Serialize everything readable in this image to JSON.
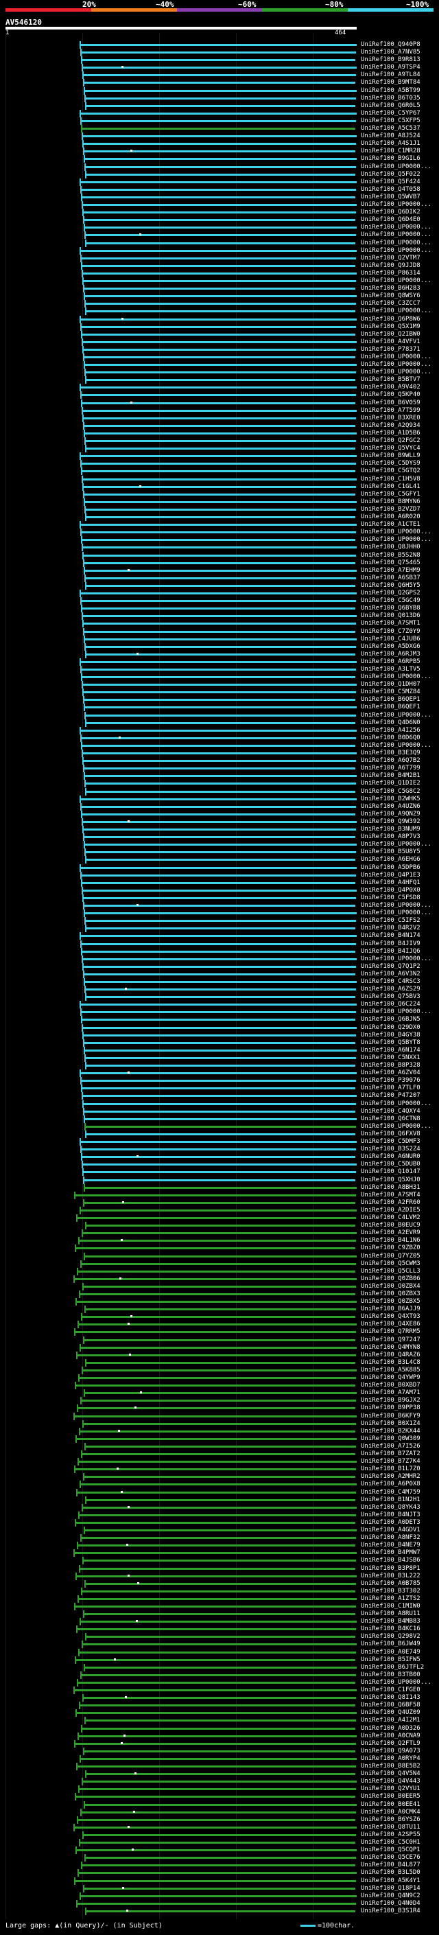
{
  "scale": {
    "labels": [
      "20%",
      "~40%",
      "~60%",
      "~80%",
      "~100%"
    ],
    "colors": [
      "#e8232b",
      "#f07c1d",
      "#8c3db0",
      "#2ea02b",
      "#3fd0ea"
    ]
  },
  "query": {
    "name": "AV546120",
    "start": "1",
    "end": "464"
  },
  "footer": {
    "large_gaps": "Large gaps: ▲(in Query)/- (in Subject)",
    "legend_label": "=100char."
  },
  "hits": [
    "UniRef100_Q940P8",
    "UniRef100_A7NV85",
    "UniRef100_B9R813",
    "UniRef100_A9TSP4",
    "UniRef100_A9TL84",
    "UniRef100_B9MT84",
    "UniRef100_A5BT99",
    "UniRef100_B6T035",
    "UniRef100_Q6R0L5",
    "UniRef100_C5YP67",
    "UniRef100_C5XFP5",
    "UniRef100_A5C537",
    "UniRef100_A8J524",
    "UniRef100_A4S1J1",
    "UniRef100_C1MR28",
    "UniRef100_B9GIL6",
    "UniRef100_UP0000...",
    "UniRef100_Q5F022",
    "UniRef100_Q5F424",
    "UniRef100_Q4T058",
    "UniRef100_Q5WVB7",
    "UniRef100_UP0000...",
    "UniRef100_Q6DIK2",
    "UniRef100_Q6D4E0",
    "UniRef100_UP0000...",
    "UniRef100_UP0000...",
    "UniRef100_UP0000...",
    "UniRef100_UP0000...",
    "UniRef100_Q2VTM7",
    "UniRef100_Q9JJD8",
    "UniRef100_P86314",
    "UniRef100_UP0000...",
    "UniRef100_B6H283",
    "UniRef100_Q8WSY6",
    "UniRef100_C3ZCC7",
    "UniRef100_UP0000...",
    "UniRef100_Q6P8W6",
    "UniRef100_Q5X1M9",
    "UniRef100_Q2IBW0",
    "UniRef100_A4VFV1",
    "UniRef100_P78371",
    "UniRef100_UP0000...",
    "UniRef100_UP0000...",
    "UniRef100_UP0000...",
    "UniRef100_B5BTV7",
    "UniRef100_A9V402",
    "UniRef100_Q5KP40",
    "UniRef100_B6V059",
    "UniRef100_A7T599",
    "UniRef100_B3XRE0",
    "UniRef100_A2Q934",
    "UniRef100_A1D5B6",
    "UniRef100_Q2FGC2",
    "UniRef100_Q5VYC4",
    "UniRef100_B9WLL9",
    "UniRef100_C5DYS9",
    "UniRef100_C5GTQ2",
    "UniRef100_C1H5V8",
    "UniRef100_C1GL41",
    "UniRef100_C5GFY1",
    "UniRef100_B8MYN6",
    "UniRef100_B2VZD7",
    "UniRef100_A6R020",
    "UniRef100_A1CTE1",
    "UniRef100_UP0000...",
    "UniRef100_UP0000...",
    "UniRef100_Q8JHH0",
    "UniRef100_B5S2N8",
    "UniRef100_Q75465",
    "UniRef100_A7EHM9",
    "UniRef100_A6SB37",
    "UniRef100_Q6H5Y5",
    "UniRef100_Q2GPS2",
    "UniRef100_C5GC49",
    "UniRef100_Q6BYB8",
    "UniRef100_Q013D6",
    "UniRef100_A7SMT1",
    "UniRef100_C7Z0Y9",
    "UniRef100_C4JUB6",
    "UniRef100_A5DXG6",
    "UniRef100_A6RJM3",
    "UniRef100_A6RPB5",
    "UniRef100_A3LTV5",
    "UniRef100_UP0000...",
    "UniRef100_Q1DH07",
    "UniRef100_C5MZ84",
    "UniRef100_B6QEP1",
    "UniRef100_B6QEF1",
    "UniRef100_UP0000...",
    "UniRef100_Q4D6N0",
    "UniRef100_A4I256",
    "UniRef100_B0D6Q0",
    "UniRef100_UP0000...",
    "UniRef100_B3E3Q9",
    "UniRef100_A6Q7B2",
    "UniRef100_A6T799",
    "UniRef100_B4M2B1",
    "UniRef100_Q1DIE2",
    "UniRef100_C5G8C2",
    "UniRef100_B2WHK5",
    "UniRef100_A4UZN6",
    "UniRef100_A9QNZ9",
    "UniRef100_Q9W392",
    "UniRef100_B3NUM9",
    "UniRef100_A8P7V3",
    "UniRef100_UP0000...",
    "UniRef100_B5U8Y5",
    "UniRef100_A6EHG6",
    "UniRef100_A5DPB6",
    "UniRef100_Q4P1E3",
    "UniRef100_A4HFQ1",
    "UniRef100_Q4P0X0",
    "UniRef100_C5FSD8",
    "UniRef100_UP0000...",
    "UniRef100_UP0000...",
    "UniRef100_C5IFS2",
    "UniRef100_B4R2V2",
    "UniRef100_B4N174",
    "UniRef100_B4JIV9",
    "UniRef100_B4IJQ6",
    "UniRef100_UP0000...",
    "UniRef100_Q7Q1P2",
    "UniRef100_A6V3N2",
    "UniRef100_C4RSC3",
    "UniRef100_A6ZS29",
    "UniRef100_Q75BV3",
    "UniRef100_Q6C224",
    "UniRef100_UP0000...",
    "UniRef100_Q6BJN5",
    "UniRef100_Q29DX0",
    "UniRef100_B4GY38",
    "UniRef100_Q5BYT8",
    "UniRef100_A6N174",
    "UniRef100_C5NXX1",
    "UniRef100_B8P328",
    "UniRef100_A6ZV04",
    "UniRef100_P39076",
    "UniRef100_A7TLF0",
    "UniRef100_P47207",
    "UniRef100_UP0000...",
    "UniRef100_C4QXY4",
    "UniRef100_Q6CTN8",
    "UniRef100_UP0000...",
    "UniRef100_Q6FXV8",
    "UniRef100_C5DMF3",
    "UniRef100_B3S2Z4",
    "UniRef100_A6NUR0",
    "UniRef100_C5DUB0",
    "UniRef100_Q10147",
    "UniRef100_Q5XHJ0",
    "UniRef100_A8BH31",
    "UniRef100_A7SMT4",
    "UniRef100_A2FR60",
    "UniRef100_A2DIE5",
    "UniRef100_C4LVM2",
    "UniRef100_B0EUC9",
    "UniRef100_A2EVR9",
    "UniRef100_B4L1N6",
    "UniRef100_C9ZBZ0",
    "UniRef100_Q7YZ05",
    "UniRef100_Q5CWM3",
    "UniRef100_Q5CLL3",
    "UniRef100_Q0ZB06",
    "UniRef100_Q0ZBX4",
    "UniRef100_Q0ZBX3",
    "UniRef100_Q0ZBX5",
    "UniRef100_B6AJJ9",
    "UniRef100_Q4XT93",
    "UniRef100_Q4XE86",
    "UniRef100_Q7RRM5",
    "UniRef100_Q97247",
    "UniRef100_Q4MYN8",
    "UniRef100_Q4RAZ6",
    "UniRef100_B3L4C8",
    "UniRef100_A5K885",
    "UniRef100_Q4YWP9",
    "UniRef100_B0XBD7",
    "UniRef100_A7AM71",
    "UniRef100_B9GJX2",
    "UniRef100_B9PP38",
    "UniRef100_B6KFY9",
    "UniRef100_B0X1Z4",
    "UniRef100_B2KX44",
    "UniRef100_Q0W309",
    "UniRef100_A7I526",
    "UniRef100_B7ZAT2",
    "UniRef100_B7Z7K4",
    "UniRef100_B1L7Z0",
    "UniRef100_A2MHR2",
    "UniRef100_A6P0X8",
    "UniRef100_C4M759",
    "UniRef100_B1N2H1",
    "UniRef100_Q8YK43",
    "UniRef100_B4NJT3",
    "UniRef100_A0DET3",
    "UniRef100_A4GDV1",
    "UniRef100_A8NF32",
    "UniRef100_B4NE79",
    "UniRef100_B4PMW7",
    "UniRef100_B4JSB6",
    "UniRef100_B3P8P1",
    "UniRef100_B3L222",
    "UniRef100_A0B785",
    "UniRef100_B3T302",
    "UniRef100_A1ZTS2",
    "UniRef100_C1MIW0",
    "UniRef100_A8RU11",
    "UniRef100_B4MB83",
    "UniRef100_B4KC16",
    "UniRef100_Q298V2",
    "UniRef100_B6JW49",
    "UniRef100_A0E749",
    "UniRef100_B5IFW5",
    "UniRef100_B6JTFL2",
    "UniRef100_B3TB00",
    "UniRef100_UP0000...",
    "UniRef100_C1FGE0",
    "UniRef100_Q8I143",
    "UniRef100_Q6BF58",
    "UniRef100_Q4UZ09",
    "UniRef100_A4I2M1",
    "UniRef100_A0D326",
    "UniRef100_A0CNA9",
    "UniRef100_Q2FTL9",
    "UniRef100_Q9A073",
    "UniRef100_A0RYP4",
    "UniRef100_B8E5B2",
    "UniRef100_Q4V5N4",
    "UniRef100_Q4V443",
    "UniRef100_Q2VYU1",
    "UniRef100_B0EER5",
    "UniRef100_B0EE41",
    "UniRef100_A0CMK4",
    "UniRef100_B6YSZ6",
    "UniRef100_Q8TU11",
    "UniRef100_A2SP55",
    "UniRef100_C5C0H1",
    "UniRef100_Q5CQP1",
    "UniRef100_Q5CE76",
    "UniRef100_B4L877",
    "UniRef100_B3L5D0",
    "UniRef100_A5K4Y1",
    "UniRef100_Q18P14",
    "UniRef100_Q4N9C2",
    "UniRef100_Q4N0D4",
    "UniRef100_B3S1R4"
  ]
}
